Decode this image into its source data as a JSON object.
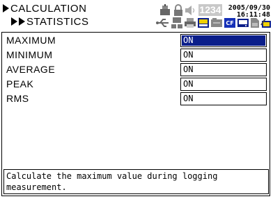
{
  "header": {
    "crumb_level1": "CALCULATION",
    "crumb_level2": "STATISTICS",
    "date": "2005/09/30",
    "time": "16:11:48",
    "counter": "1234"
  },
  "rows": [
    {
      "label": "MAXIMUM",
      "value": "ON",
      "selected": true
    },
    {
      "label": "MINIMUM",
      "value": "ON",
      "selected": false
    },
    {
      "label": "AVERAGE",
      "value": "ON",
      "selected": false
    },
    {
      "label": "PEAK",
      "value": "ON",
      "selected": false
    },
    {
      "label": "RMS",
      "value": "ON",
      "selected": false
    }
  ],
  "help_text": "Calculate the maximum value during logging measurement.",
  "colors": {
    "selection": "#0b1e8a",
    "counter_bg": "#c8c8c8"
  },
  "icons": [
    "trigger-icon",
    "lock-icon",
    "speaker-icon",
    "usb-icon",
    "network-icon",
    "printer-icon",
    "cf-card-icon",
    "memory-icon",
    "disk-icon",
    "battery-icon"
  ]
}
